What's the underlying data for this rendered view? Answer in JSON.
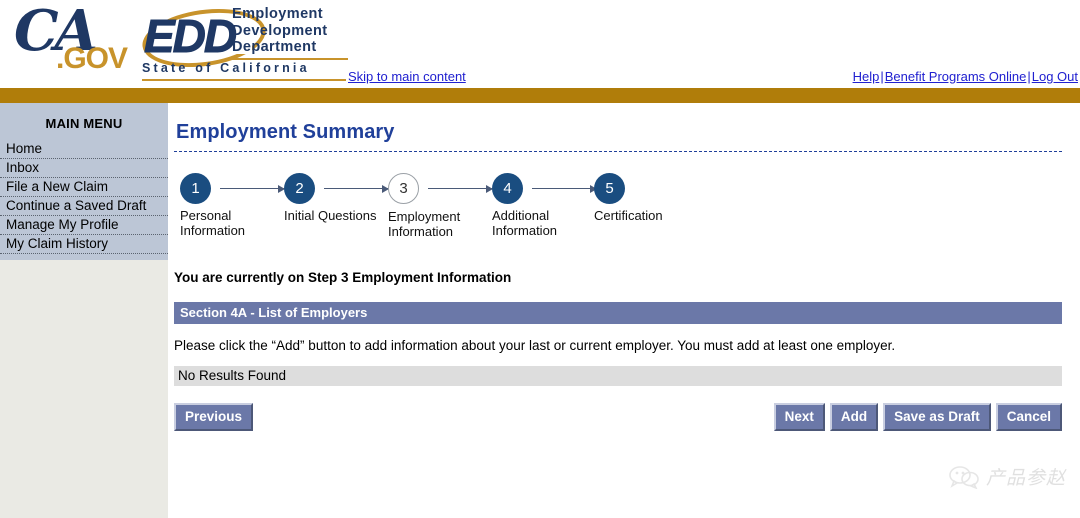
{
  "header": {
    "ca_logo": {
      "script": "CA",
      "gov": ".GOV",
      "icon": "ca-gov-logo"
    },
    "edd_logo": {
      "acronym": "EDD",
      "line1": "Employment",
      "line2": "Development",
      "line3": "Department",
      "state": "State of California"
    },
    "skip_link": "Skip to main content",
    "links": [
      {
        "label": "Help"
      },
      {
        "label": "Benefit Programs Online"
      },
      {
        "label": "Log Out"
      }
    ],
    "separator": "|"
  },
  "sidebar": {
    "title": "MAIN MENU",
    "items": [
      {
        "label": "Home"
      },
      {
        "label": "Inbox"
      },
      {
        "label": "File a New Claim"
      },
      {
        "label": "Continue a Saved Draft"
      },
      {
        "label": "Manage My Profile"
      },
      {
        "label": "My Claim History"
      }
    ]
  },
  "main": {
    "page_title": "Employment Summary",
    "steps": [
      {
        "number": "1",
        "label": "Personal\nInformation",
        "state": "done"
      },
      {
        "number": "2",
        "label": "Initial Questions",
        "state": "done"
      },
      {
        "number": "3",
        "label": "Employment\nInformation",
        "state": "current"
      },
      {
        "number": "4",
        "label": "Additional\nInformation",
        "state": "done"
      },
      {
        "number": "5",
        "label": "Certification",
        "state": "done"
      }
    ],
    "current_step_text": "You are currently on Step 3 Employment Information",
    "section_header": "Section 4A - List of Employers",
    "instruction": "Please click the “Add” button to add information about your last or current employer. You must add at least one employer.",
    "results_text": "No Results Found",
    "buttons": {
      "previous": "Previous",
      "next": "Next",
      "add": "Add",
      "save_as_draft": "Save as Draft",
      "cancel": "Cancel"
    }
  },
  "watermark": {
    "text": "产品参赵",
    "icon": "wechat-bubble-icon"
  },
  "colors": {
    "gold_bar": "#b07d0a",
    "brand_navy": "#1f3864",
    "title_blue": "#20409a",
    "section_blue": "#6b78a8",
    "sidebar_menu": "#bcc6d6",
    "sidebar_panel": "#eaeae4",
    "link_blue": "#2020d0"
  }
}
